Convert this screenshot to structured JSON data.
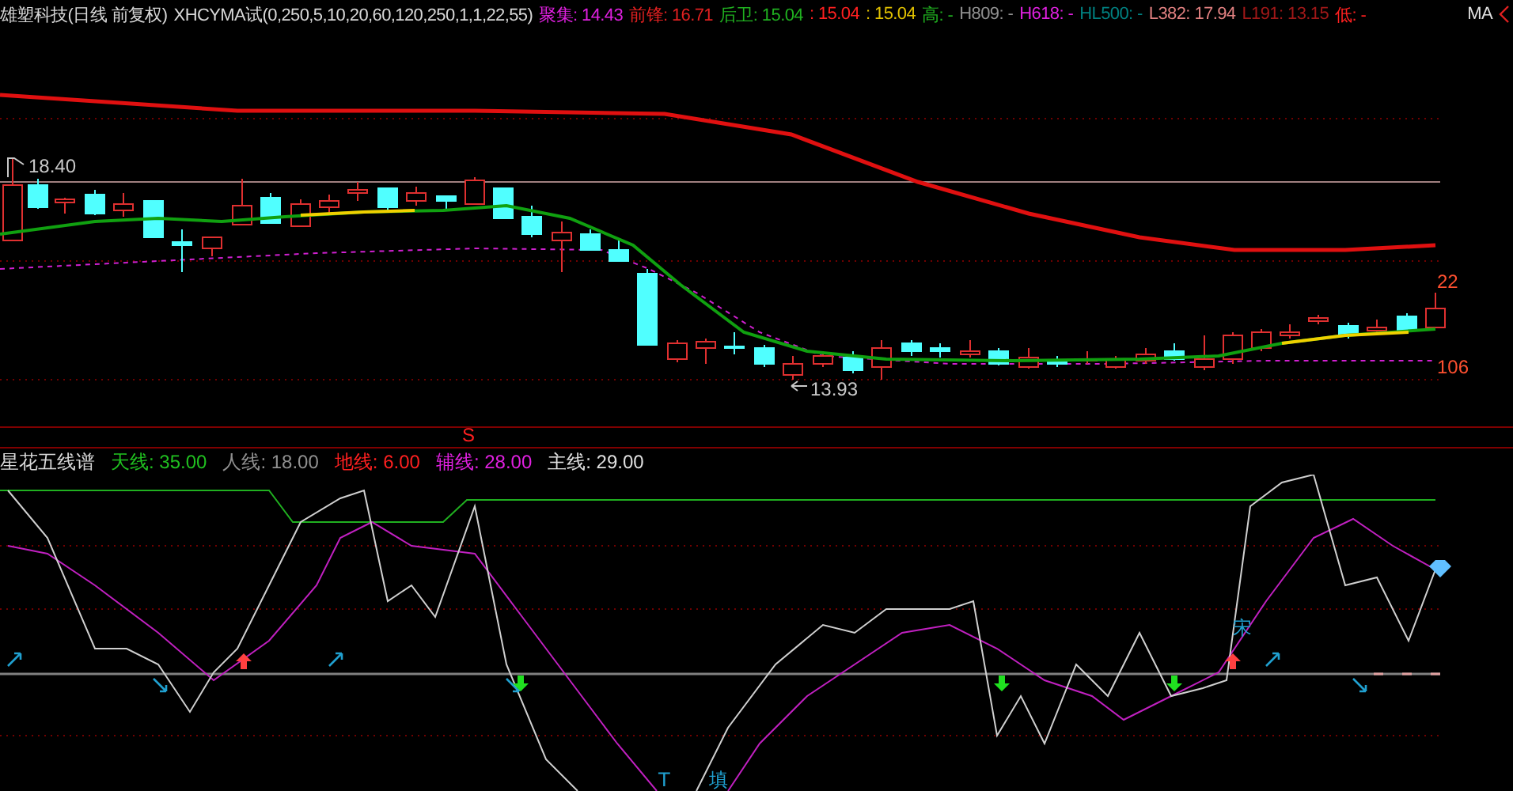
{
  "header": {
    "title": "雄塑科技(日线 前复权)",
    "indicator": "XHCYMA试(0,250,5,10,20,60,120,250,1,1,22,55)",
    "values": [
      {
        "text": "聚集: 14.43",
        "color": "#e020e0"
      },
      {
        "text": "前锋: 16.71",
        "color": "#e02020"
      },
      {
        "text": "后卫: 15.04",
        "color": "#20b020"
      },
      {
        "text": ": 15.04",
        "color": "#ff2020"
      },
      {
        "text": ": 15.04",
        "color": "#e0c000"
      },
      {
        "text": "高: -",
        "color": "#20b020"
      },
      {
        "text": "H809: -",
        "color": "#909090"
      },
      {
        "text": "H618: -",
        "color": "#e020e0"
      },
      {
        "text": "HL500: -",
        "color": "#008080"
      },
      {
        "text": "L382: 17.94",
        "color": "#e08080"
      },
      {
        "text": "L191: 13.15",
        "color": "#a01818"
      },
      {
        "text": "低: -",
        "color": "#ff2020"
      }
    ],
    "ma_label": "MA"
  },
  "price_chart": {
    "labels": [
      "18.40",
      "13.93",
      "22",
      "106",
      "S"
    ]
  },
  "indicator_header": {
    "title": "星花五线谱",
    "values": [
      {
        "text": "天线: 35.00",
        "color": "#20c020"
      },
      {
        "text": "人线: 18.00",
        "color": "#909090"
      },
      {
        "text": "地线: 6.00",
        "color": "#ff2020"
      },
      {
        "text": "辅线: 28.00",
        "color": "#e020e0"
      },
      {
        "text": "主线: 29.00",
        "color": "#e0e0e0"
      }
    ]
  },
  "indicator_chart": {
    "labels": [
      "宋",
      "T",
      "填"
    ]
  }
}
